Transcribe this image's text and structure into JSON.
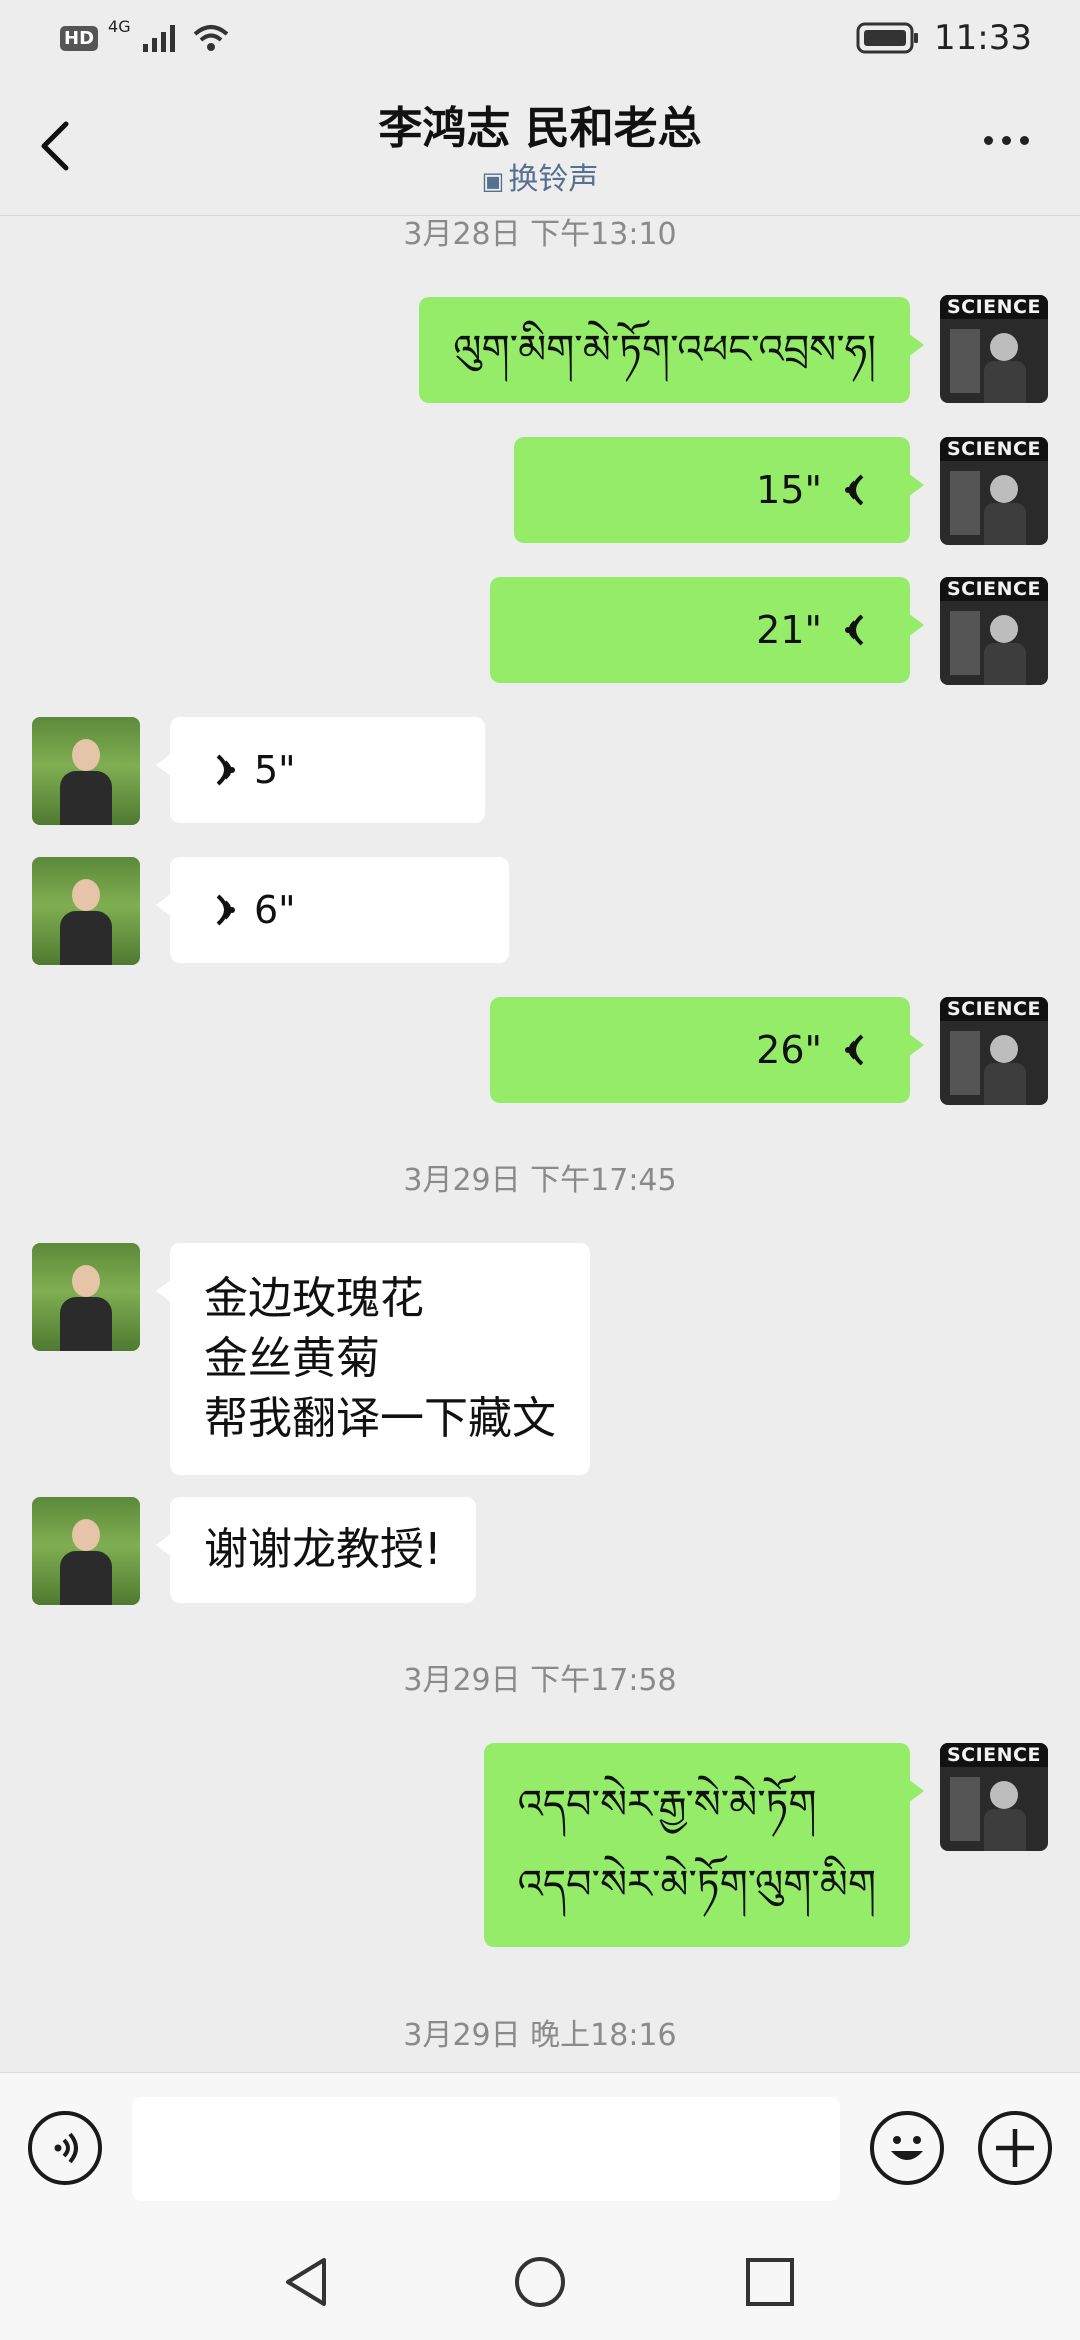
{
  "status_bar": {
    "hd": "HD",
    "network": "4G",
    "time": "11:33"
  },
  "header": {
    "title": "李鸿志 民和老总",
    "subtitle": "换铃声"
  },
  "chat": {
    "timestamps": [
      "3月28日 下午13:10",
      "3月29日 下午17:45",
      "3月29日 下午17:58",
      "3月29日 晚上18:16"
    ],
    "avatar_label": "SCIENCE",
    "messages": [
      {
        "sender": "me",
        "type": "text",
        "text": "ལུག་མིག་མེ་ཏོག་འཕང་འབྲས་ཧ།"
      },
      {
        "sender": "me",
        "type": "voice",
        "duration": "15\""
      },
      {
        "sender": "me",
        "type": "voice",
        "duration": "21\""
      },
      {
        "sender": "other",
        "type": "voice",
        "duration": "5\""
      },
      {
        "sender": "other",
        "type": "voice",
        "duration": "6\""
      },
      {
        "sender": "me",
        "type": "voice",
        "duration": "26\""
      },
      {
        "sender": "other",
        "type": "text",
        "lines": [
          "金边玫瑰花",
          "金丝黄菊",
          "帮我翻译一下藏文"
        ]
      },
      {
        "sender": "other",
        "type": "text",
        "text": "谢谢龙教授!"
      },
      {
        "sender": "me",
        "type": "text",
        "lines": [
          "འདབ་སེར་རྒྱ་སེ་མེ་ཏོག",
          "འདབ་སེར་མེ་ཏོག་ལུག་མིག"
        ]
      }
    ]
  },
  "input_bar": {
    "placeholder": ""
  },
  "icons": {
    "status": [
      "hd-badge",
      "signal-icon",
      "wifi-icon",
      "battery-icon"
    ],
    "header": [
      "back-arrow-icon",
      "more-dots-icon",
      "bell-icon"
    ],
    "input": [
      "voice-mode-icon",
      "emoji-icon",
      "plus-icon"
    ],
    "sysnav": [
      "nav-back-icon",
      "nav-home-icon",
      "nav-recents-icon"
    ]
  },
  "colors": {
    "my_bubble": "#95ec69",
    "other_bubble": "#ffffff",
    "background": "#ededed",
    "link": "#57708f"
  }
}
